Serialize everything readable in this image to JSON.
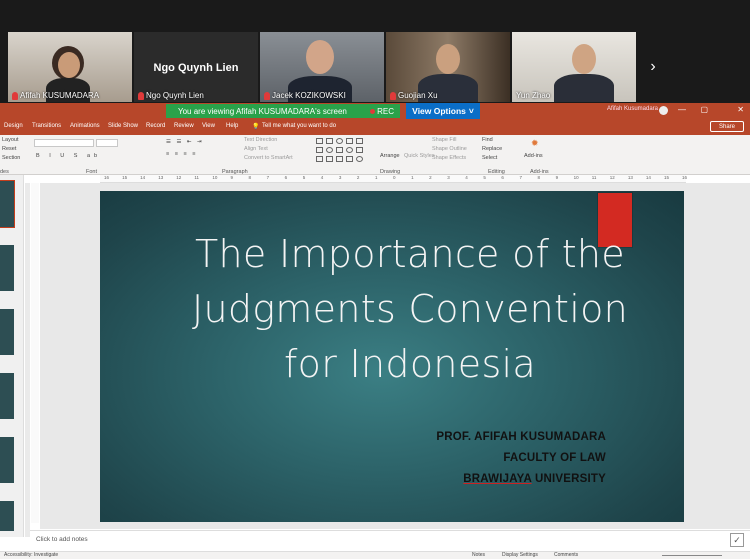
{
  "meeting": {
    "participants": [
      {
        "name": "Afifah KUSUMADARA",
        "muted": true,
        "active": true
      },
      {
        "name": "Ngo Quynh Lien",
        "muted": true,
        "video_off_label": "Ngo Quynh Lien"
      },
      {
        "name": "Jacek KOZIKOWSKI",
        "muted": true
      },
      {
        "name": "Guojian Xu",
        "muted": true
      },
      {
        "name": "Yun Zhao",
        "muted": false
      }
    ],
    "next_icon": "chevron-right-icon",
    "viewing_banner": "You are viewing  Afifah KUSUMADARA's screen",
    "rec_label": "REC",
    "view_options_label": "View Options"
  },
  "ppt": {
    "user_name": "Afifah Kusumadara",
    "window_controls": [
      "—",
      "▢",
      "✕"
    ],
    "tabs": [
      "Design",
      "Transitions",
      "Animations",
      "Slide Show",
      "Record",
      "Review",
      "View",
      "Help"
    ],
    "tell_me": "Tell me what you want to do",
    "share_label": "Share",
    "ribbon": {
      "slides_items": [
        "Layout",
        "Reset",
        "Section"
      ],
      "groups": [
        "des",
        "Font",
        "Paragraph",
        "Drawing",
        "Editing",
        "Add-ins"
      ],
      "paragraph_items": [
        "Text Direction",
        "Align Text",
        "Convert to SmartArt"
      ],
      "drawing_items": [
        "Arrange",
        "Quick Styles",
        "Shape Fill",
        "Shape Outline",
        "Shape Effects"
      ],
      "editing_items": [
        "Find",
        "Replace",
        "Select"
      ],
      "addins_label": "Add-ins"
    },
    "ruler_ticks": [
      "16",
      "15",
      "14",
      "13",
      "12",
      "11",
      "10",
      "9",
      "8",
      "7",
      "6",
      "5",
      "4",
      "3",
      "2",
      "1",
      "0",
      "1",
      "2",
      "3",
      "4",
      "5",
      "6",
      "7",
      "8",
      "9",
      "10",
      "11",
      "12",
      "13",
      "14",
      "15",
      "16"
    ],
    "notes_placeholder": "Click to add notes",
    "status": {
      "accessibility": "Accessibility: Investigate",
      "notes": "Notes",
      "display_settings": "Display Settings",
      "comments": "Comments"
    }
  },
  "slide": {
    "title_lines": [
      "The Importance of the",
      "Judgments Convention",
      "for Indonesia"
    ],
    "author": "PROF. AFIFAH KUSUMADARA",
    "faculty": "FACULTY OF LAW",
    "university_a": "BRAWIJAYA",
    "university_b": " UNIVERSITY",
    "colors": {
      "accent": "#d32a22",
      "bg": "#2c6268"
    }
  }
}
